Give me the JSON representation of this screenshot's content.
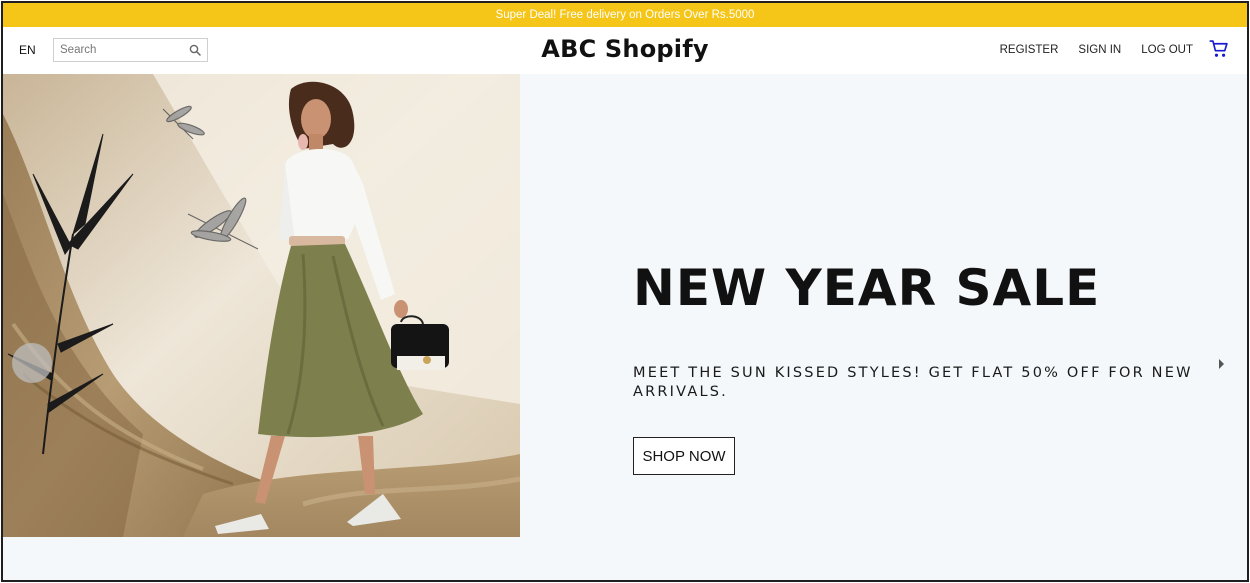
{
  "announcement": {
    "text": "Super Deal! Free delivery on Orders Over Rs.5000"
  },
  "header": {
    "language": "EN",
    "search_placeholder": "Search",
    "brand": "ABC Shopify",
    "links": {
      "register": "REGISTER",
      "sign_in": "SIGN IN",
      "log_out": "LOG OUT"
    },
    "cart_icon": "shopping-cart-icon"
  },
  "hero": {
    "headline": "NEW YEAR SALE",
    "subline": "MEET THE SUN KISSED STYLES! GET FLAT 50% OFF FOR NEW ARRIVALS.",
    "cta": "SHOP NOW",
    "image_icon": "fashion-model-photo"
  },
  "colors": {
    "announcement_bg": "#f5c518",
    "cart_icon": "#1a1ad1",
    "hero_bg": "#f4f8fb"
  }
}
